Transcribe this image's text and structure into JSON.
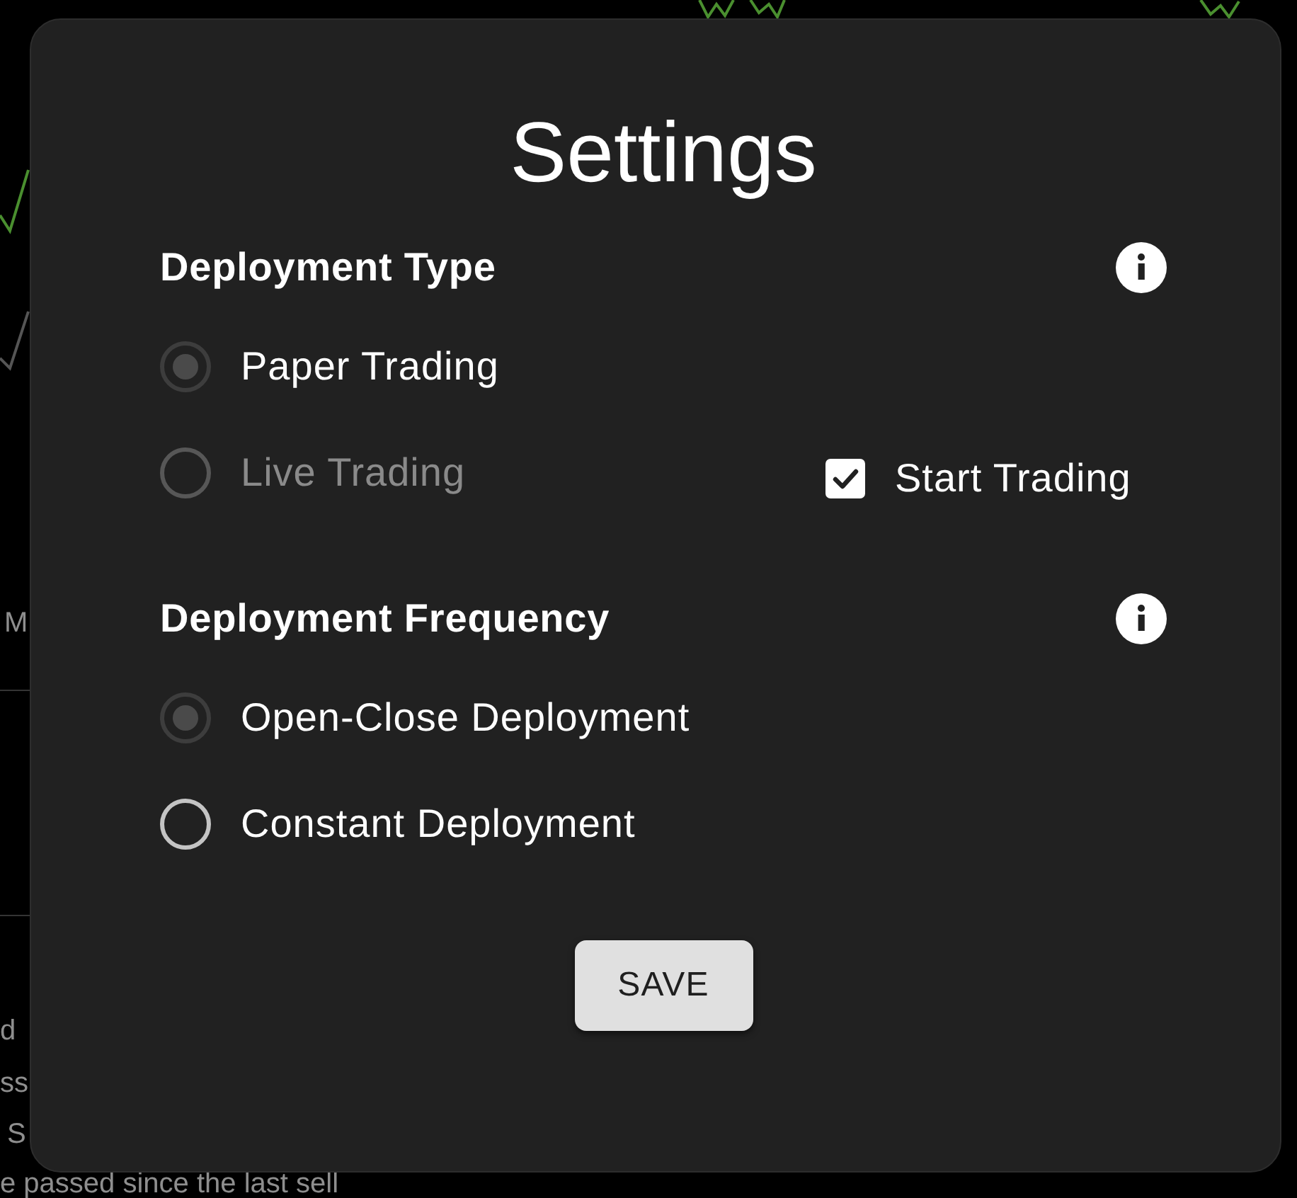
{
  "background": {
    "fragments": [
      {
        "text": "M"
      },
      {
        "text": "d"
      },
      {
        "text": "ss"
      },
      {
        "text": "S"
      },
      {
        "text": "e passed since the last sell"
      }
    ]
  },
  "dialog": {
    "title": "Settings",
    "sections": [
      {
        "heading": "Deployment Type",
        "options": [
          {
            "label": "Paper Trading",
            "selected": true,
            "disabled": false
          },
          {
            "label": "Live Trading",
            "selected": false,
            "disabled": true
          }
        ],
        "checkbox": {
          "label": "Start Trading",
          "checked": true
        }
      },
      {
        "heading": "Deployment Frequency",
        "options": [
          {
            "label": "Open-Close Deployment",
            "selected": true,
            "disabled": false
          },
          {
            "label": "Constant Deployment",
            "selected": false,
            "disabled": false
          }
        ]
      }
    ],
    "save_button": "SAVE"
  }
}
